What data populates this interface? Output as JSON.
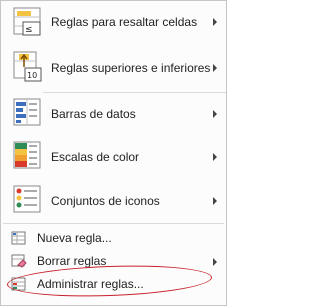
{
  "menu": {
    "items": [
      {
        "label": "Reglas para resaltar celdas",
        "icon": "highlight-rules-icon",
        "submenu": true
      },
      {
        "label": "Reglas superiores e inferiores",
        "icon": "top-bottom-rules-icon",
        "submenu": true
      },
      {
        "label": "Barras de datos",
        "icon": "data-bars-icon",
        "submenu": true
      },
      {
        "label": "Escalas de color",
        "icon": "color-scales-icon",
        "submenu": true
      },
      {
        "label": "Conjuntos de iconos",
        "icon": "icon-sets-icon",
        "submenu": true
      }
    ],
    "actions": [
      {
        "label": "Nueva regla...",
        "icon": "new-rule-icon"
      },
      {
        "label": "Borrar reglas",
        "icon": "clear-rules-icon",
        "submenu": true
      },
      {
        "label": "Administrar reglas...",
        "icon": "manage-rules-icon"
      }
    ],
    "highlight_color": "#c8202a"
  }
}
